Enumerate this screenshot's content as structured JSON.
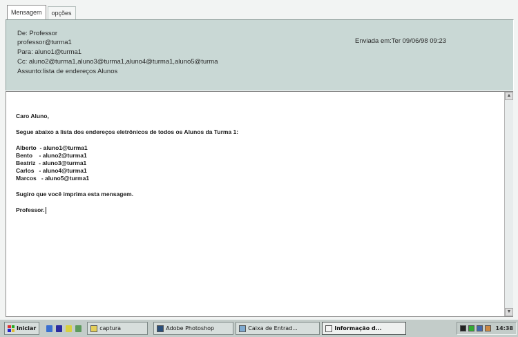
{
  "tabs": [
    {
      "label": "Mensagem",
      "active": true
    },
    {
      "label": "opções",
      "active": false
    }
  ],
  "header": {
    "from": "De: Professor",
    "from_email": "professor@turma1",
    "to": "Para: aluno1@turma1",
    "cc": "Cc: aluno2@turma1,aluno3@turma1,aluno4@turma1,aluno5@turma",
    "subject": "Assunto:lista de endereços Alunos",
    "sent": "Enviada em:Ter 09/06/98 09:23"
  },
  "message": {
    "greeting": "Caro Aluno,",
    "intro": "Segue abaixo a lista dos endereços eletrônicos de todos os Alunos da Turma 1:",
    "students": [
      "Alberto  - aluno1@turma1",
      "Bento    - aluno2@turma1",
      "Beatriz  - aluno3@turma1",
      "Carlos   - aluno4@turma1",
      "Marcos   - aluno5@turma1"
    ],
    "suggestion": "Sugiro que você imprima esta mensagem.",
    "signature": "Professor."
  },
  "taskbar": {
    "start_label": "Iniciar",
    "tasks": [
      {
        "label": "captura",
        "pressed": false
      },
      {
        "label": "Adobe Photoshop",
        "pressed": false
      },
      {
        "label": "Caixa de Entrad...",
        "pressed": false
      },
      {
        "label": "Informação d...",
        "pressed": true
      }
    ],
    "clock": "14:38"
  },
  "colors": {
    "header_bg": "#c9d8d5",
    "taskbar_bg": "#c3ccc9",
    "body_bg": "#ffffff"
  }
}
